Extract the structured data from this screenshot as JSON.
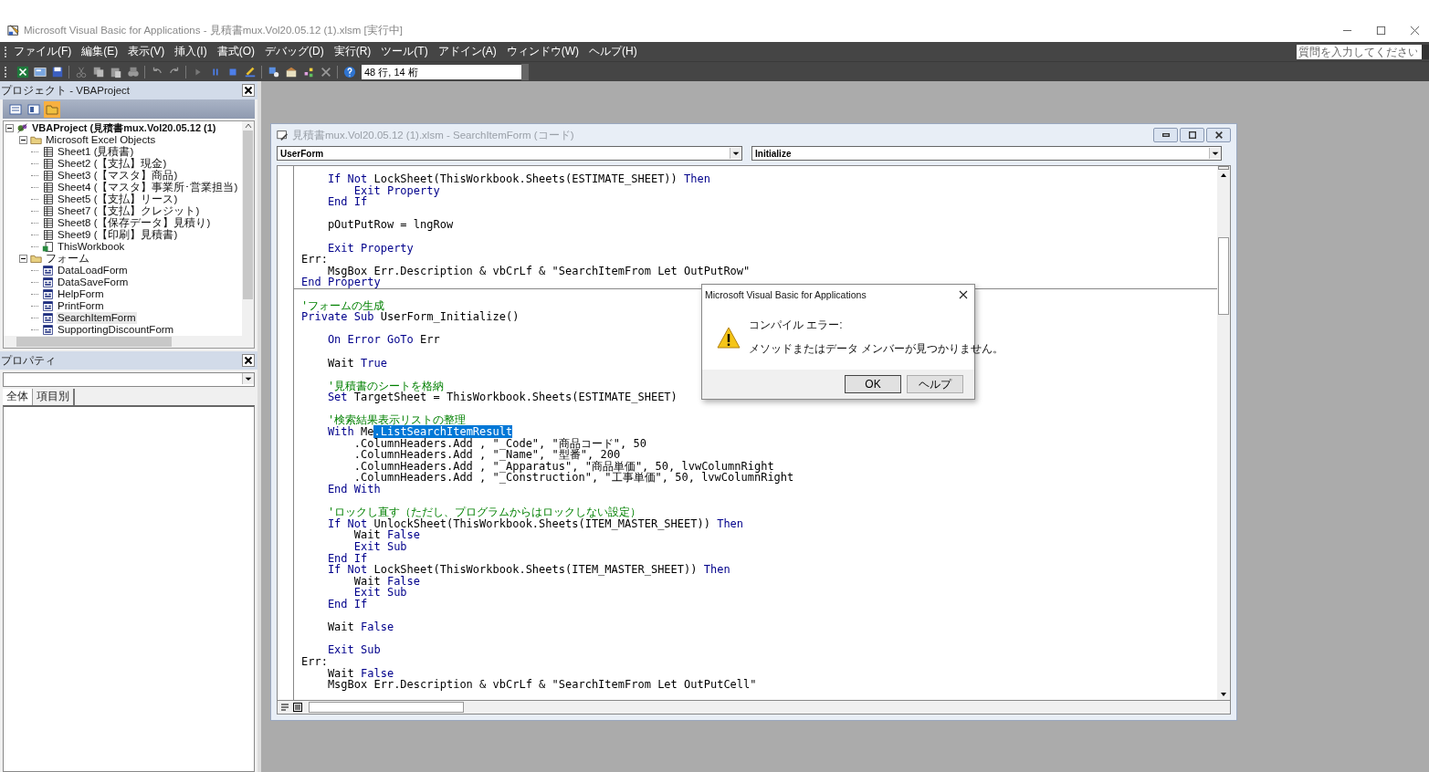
{
  "window": {
    "title": "Microsoft Visual Basic for Applications - 見積書mux.Vol20.05.12 (1).xlsm [実行中]"
  },
  "menu": [
    "ファイル(F)",
    "編集(E)",
    "表示(V)",
    "挿入(I)",
    "書式(O)",
    "デバッグ(D)",
    "実行(R)",
    "ツール(T)",
    "アドイン(A)",
    "ウィンドウ(W)",
    "ヘルプ(H)"
  ],
  "help_search": {
    "placeholder": "質問を入力してください"
  },
  "toolbar": {
    "position": "48 行, 14 桁"
  },
  "project_pane": {
    "title": "プロジェクト - VBAProject",
    "tree": [
      {
        "label": "VBAProject (見積書mux.Vol20.05.12 (1)",
        "kind": "project",
        "expanded": true,
        "selected": false,
        "children": [
          {
            "label": "Microsoft Excel Objects",
            "kind": "folder",
            "expanded": true,
            "selected": false,
            "children": [
              {
                "label": "Sheet1 (見積書)",
                "kind": "sheet",
                "selected": false
              },
              {
                "label": "Sheet2 (【支払】現金)",
                "kind": "sheet",
                "selected": false
              },
              {
                "label": "Sheet3 (【マスタ】商品)",
                "kind": "sheet",
                "selected": false
              },
              {
                "label": "Sheet4 (【マスタ】事業所･営業担当)",
                "kind": "sheet",
                "selected": false
              },
              {
                "label": "Sheet5 (【支払】リース)",
                "kind": "sheet",
                "selected": false
              },
              {
                "label": "Sheet7 (【支払】クレジット)",
                "kind": "sheet",
                "selected": false
              },
              {
                "label": "Sheet8 (【保存データ】見積り)",
                "kind": "sheet",
                "selected": false
              },
              {
                "label": "Sheet9 (【印刷】見積書)",
                "kind": "sheet",
                "selected": false
              },
              {
                "label": "ThisWorkbook",
                "kind": "workbook",
                "selected": false
              }
            ]
          },
          {
            "label": "フォーム",
            "kind": "folder",
            "expanded": true,
            "selected": false,
            "children": [
              {
                "label": "DataLoadForm",
                "kind": "form",
                "selected": false
              },
              {
                "label": "DataSaveForm",
                "kind": "form",
                "selected": false
              },
              {
                "label": "HelpForm",
                "kind": "form",
                "selected": false
              },
              {
                "label": "PrintForm",
                "kind": "form",
                "selected": false
              },
              {
                "label": "SearchItemForm",
                "kind": "form",
                "selected": true
              },
              {
                "label": "SupportingDiscountForm",
                "kind": "form",
                "selected": false
              }
            ]
          }
        ]
      }
    ]
  },
  "properties_pane": {
    "title": "プロパティ",
    "tabs": [
      {
        "label": "全体",
        "selected": true
      },
      {
        "label": "項目別",
        "selected": false
      }
    ]
  },
  "code_window": {
    "title": "見積書mux.Vol20.05.12 (1).xlsm - SearchItemForm (コード)",
    "object": "UserForm",
    "procedure": "Initialize",
    "lines": [
      {
        "kind": "code",
        "tokens": [
          {
            "kind": "keyword",
            "text": "    If Not"
          },
          {
            "kind": "plain",
            "text": " LockSheet(ThisWorkbook.Sheets(ESTIMATE_SHEET)) "
          },
          {
            "kind": "keyword",
            "text": "Then"
          }
        ]
      },
      {
        "kind": "code",
        "tokens": [
          {
            "kind": "keyword",
            "text": "        Exit Property"
          }
        ]
      },
      {
        "kind": "code",
        "tokens": [
          {
            "kind": "keyword",
            "text": "    End If"
          }
        ]
      },
      {
        "kind": "blank"
      },
      {
        "kind": "code",
        "tokens": [
          {
            "kind": "plain",
            "text": "    pOutPutRow = lngRow"
          }
        ]
      },
      {
        "kind": "blank"
      },
      {
        "kind": "code",
        "tokens": [
          {
            "kind": "keyword",
            "text": "    Exit Property"
          }
        ]
      },
      {
        "kind": "code",
        "tokens": [
          {
            "kind": "plain",
            "text": "Err:"
          }
        ]
      },
      {
        "kind": "code",
        "tokens": [
          {
            "kind": "plain",
            "text": "    MsgBox Err.Description & vbCrLf & \"SearchItemFrom Let OutPutRow\""
          }
        ]
      },
      {
        "kind": "code",
        "tokens": [
          {
            "kind": "keyword",
            "text": "End Property"
          }
        ]
      },
      {
        "kind": "divider"
      },
      {
        "kind": "code",
        "tokens": [
          {
            "kind": "comment",
            "text": "'フォームの生成"
          }
        ]
      },
      {
        "kind": "code",
        "tokens": [
          {
            "kind": "keyword",
            "text": "Private Sub"
          },
          {
            "kind": "plain",
            "text": " UserForm_Initialize()"
          }
        ]
      },
      {
        "kind": "blank"
      },
      {
        "kind": "code",
        "tokens": [
          {
            "kind": "keyword",
            "text": "    On Error GoTo"
          },
          {
            "kind": "plain",
            "text": " Err"
          }
        ]
      },
      {
        "kind": "blank"
      },
      {
        "kind": "code",
        "tokens": [
          {
            "kind": "plain",
            "text": "    Wait "
          },
          {
            "kind": "keyword",
            "text": "True"
          }
        ]
      },
      {
        "kind": "blank"
      },
      {
        "kind": "code",
        "tokens": [
          {
            "kind": "comment",
            "text": "    '見積書のシートを格納"
          }
        ]
      },
      {
        "kind": "code",
        "tokens": [
          {
            "kind": "keyword",
            "text": "    Set"
          },
          {
            "kind": "plain",
            "text": " TargetSheet = ThisWorkbook.Sheets(ESTIMATE_SHEET)"
          }
        ]
      },
      {
        "kind": "blank"
      },
      {
        "kind": "code",
        "tokens": [
          {
            "kind": "comment",
            "text": "    '検索結果表示リストの整理"
          }
        ]
      },
      {
        "kind": "code",
        "tokens": [
          {
            "kind": "keyword",
            "text": "    With"
          },
          {
            "kind": "plain",
            "text": " Me"
          },
          {
            "kind": "selection",
            "text": ".ListSearchItemResult"
          }
        ]
      },
      {
        "kind": "code",
        "tokens": [
          {
            "kind": "plain",
            "text": "        .ColumnHeaders.Add , \"_Code\", \"商品コード\", 50"
          }
        ]
      },
      {
        "kind": "code",
        "tokens": [
          {
            "kind": "plain",
            "text": "        .ColumnHeaders.Add , \"_Name\", \"型番\", 200"
          }
        ]
      },
      {
        "kind": "code",
        "tokens": [
          {
            "kind": "plain",
            "text": "        .ColumnHeaders.Add , \"_Apparatus\", \"商品単価\", 50, lvwColumnRight"
          }
        ]
      },
      {
        "kind": "code",
        "tokens": [
          {
            "kind": "plain",
            "text": "        .ColumnHeaders.Add , \"_Construction\", \"工事単価\", 50, lvwColumnRight"
          }
        ]
      },
      {
        "kind": "code",
        "tokens": [
          {
            "kind": "keyword",
            "text": "    End With"
          }
        ]
      },
      {
        "kind": "blank"
      },
      {
        "kind": "code",
        "tokens": [
          {
            "kind": "comment",
            "text": "    'ロックし直す（ただし、プログラムからはロックしない設定）"
          }
        ]
      },
      {
        "kind": "code",
        "tokens": [
          {
            "kind": "keyword",
            "text": "    If Not"
          },
          {
            "kind": "plain",
            "text": " UnlockSheet(ThisWorkbook.Sheets(ITEM_MASTER_SHEET)) "
          },
          {
            "kind": "keyword",
            "text": "Then"
          }
        ]
      },
      {
        "kind": "code",
        "tokens": [
          {
            "kind": "plain",
            "text": "        Wait "
          },
          {
            "kind": "keyword",
            "text": "False"
          }
        ]
      },
      {
        "kind": "code",
        "tokens": [
          {
            "kind": "keyword",
            "text": "        Exit Sub"
          }
        ]
      },
      {
        "kind": "code",
        "tokens": [
          {
            "kind": "keyword",
            "text": "    End If"
          }
        ]
      },
      {
        "kind": "code",
        "tokens": [
          {
            "kind": "keyword",
            "text": "    If Not"
          },
          {
            "kind": "plain",
            "text": " LockSheet(ThisWorkbook.Sheets(ITEM_MASTER_SHEET)) "
          },
          {
            "kind": "keyword",
            "text": "Then"
          }
        ]
      },
      {
        "kind": "code",
        "tokens": [
          {
            "kind": "plain",
            "text": "        Wait "
          },
          {
            "kind": "keyword",
            "text": "False"
          }
        ]
      },
      {
        "kind": "code",
        "tokens": [
          {
            "kind": "keyword",
            "text": "        Exit Sub"
          }
        ]
      },
      {
        "kind": "code",
        "tokens": [
          {
            "kind": "keyword",
            "text": "    End If"
          }
        ]
      },
      {
        "kind": "blank"
      },
      {
        "kind": "code",
        "tokens": [
          {
            "kind": "plain",
            "text": "    Wait "
          },
          {
            "kind": "keyword",
            "text": "False"
          }
        ]
      },
      {
        "kind": "blank"
      },
      {
        "kind": "code",
        "tokens": [
          {
            "kind": "keyword",
            "text": "    Exit Sub"
          }
        ]
      },
      {
        "kind": "code",
        "tokens": [
          {
            "kind": "plain",
            "text": "Err:"
          }
        ]
      },
      {
        "kind": "code",
        "tokens": [
          {
            "kind": "plain",
            "text": "    Wait "
          },
          {
            "kind": "keyword",
            "text": "False"
          }
        ]
      },
      {
        "kind": "code",
        "tokens": [
          {
            "kind": "plain",
            "text": "    MsgBox Err.Description & vbCrLf & \"SearchItemFrom Let OutPutCell\""
          }
        ]
      }
    ]
  },
  "dialog": {
    "title": "Microsoft Visual Basic for Applications",
    "heading": "コンパイル エラー:",
    "message": "メソッドまたはデータ メンバーが見つかりません。",
    "buttons": [
      "OK",
      "ヘルプ"
    ]
  }
}
